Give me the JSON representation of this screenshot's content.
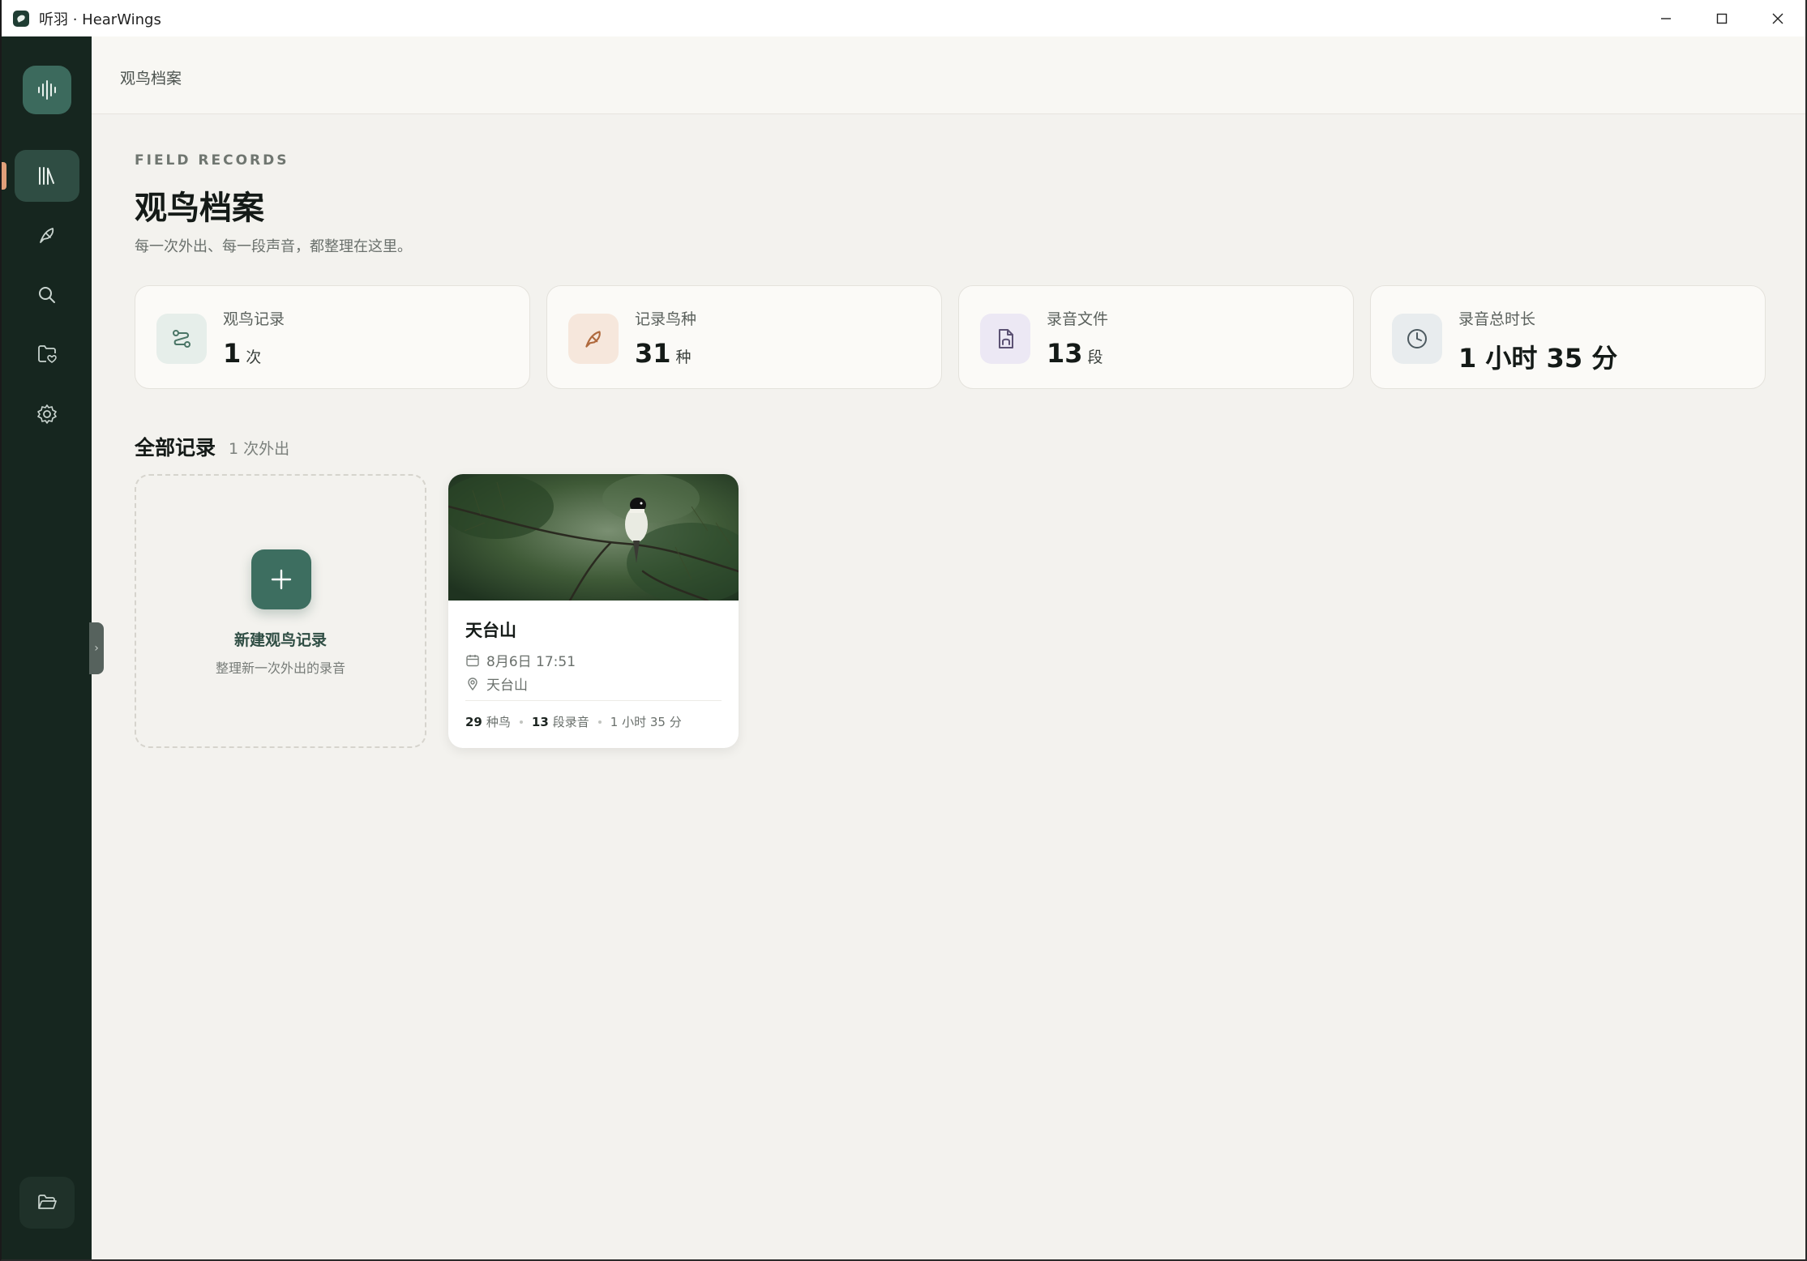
{
  "window": {
    "title": "听羽 · HearWings"
  },
  "header": {
    "breadcrumb": "观鸟档案"
  },
  "page": {
    "eyebrow": "FIELD RECORDS",
    "title": "观鸟档案",
    "subtitle": "每一次外出、每一段声音，都整理在这里。"
  },
  "stats": [
    {
      "label": "观鸟记录",
      "value": "1",
      "unit": "次",
      "icon": "route-icon",
      "bg": "#e6eeea",
      "color": "#4a7566"
    },
    {
      "label": "记录鸟种",
      "value": "31",
      "unit": "种",
      "icon": "bird-icon",
      "bg": "#f6e7dc",
      "color": "#b06a3e"
    },
    {
      "label": "录音文件",
      "value": "13",
      "unit": "段",
      "icon": "audio-file-icon",
      "bg": "#ece8f4",
      "color": "#5c5274"
    },
    {
      "label": "录音总时长",
      "value": "1 小时 35 分",
      "unit": "",
      "icon": "clock-icon",
      "bg": "#e8ecee",
      "color": "#4d5a60"
    }
  ],
  "section": {
    "title": "全部记录",
    "count": "1 次外出"
  },
  "new_card": {
    "title": "新建观鸟记录",
    "subtitle": "整理新一次外出的录音"
  },
  "records": [
    {
      "title": "天台山",
      "date": "8月6日 17:51",
      "location": "天台山",
      "species_count": "29",
      "species_label": "种鸟",
      "recording_count": "13",
      "recording_label": "段录音",
      "duration": "1 小时 35 分"
    }
  ],
  "colors": {
    "sidebar": "#16261f",
    "accent": "#3d6e60",
    "indicator": "#e0a07a"
  }
}
